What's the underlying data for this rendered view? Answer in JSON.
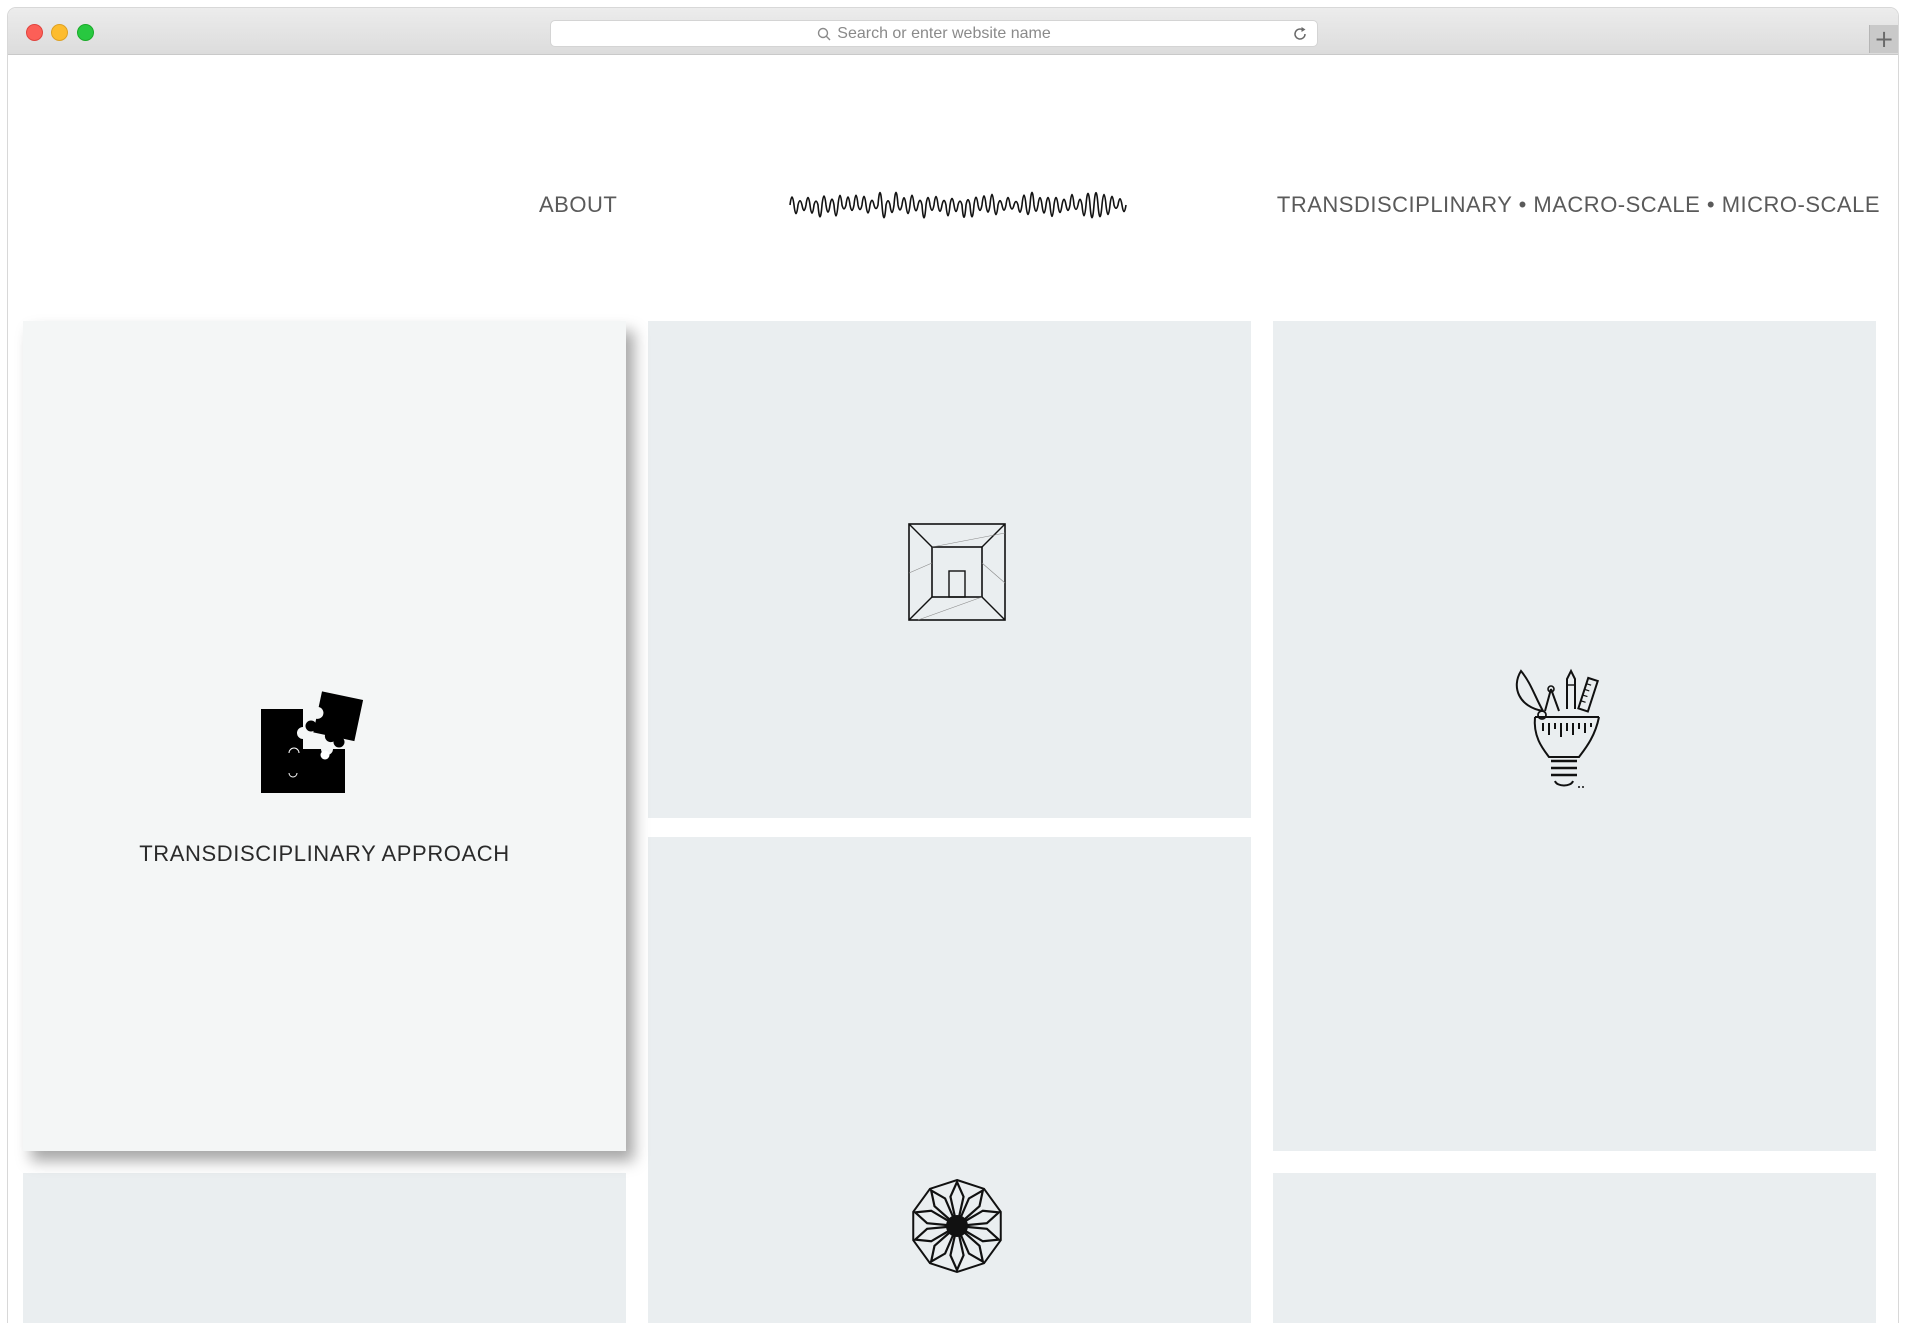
{
  "browser": {
    "address_placeholder": "Search or enter website name",
    "new_tab_label": "+",
    "traffic_lights": [
      "close",
      "minimize",
      "zoom"
    ]
  },
  "nav": {
    "about_label": "ABOUT",
    "logo_icon": "waveform-logo-icon",
    "right_label": "TRANSDISCIPLINARY • MACRO-SCALE • MICRO-SCALE"
  },
  "tiles": [
    {
      "icon": "puzzle-icon",
      "label": "TRANSDISCIPLINARY APPROACH",
      "featured": true
    },
    {
      "icon": "room-perspective-icon",
      "label": ""
    },
    {
      "icon": "lightbulb-tools-icon",
      "label": ""
    },
    {
      "icon": "geometric-flower-icon",
      "label": ""
    }
  ],
  "colors": {
    "tile_bg": "#eaeef0",
    "featured_bg": "#f4f6f6",
    "nav_text": "#5a5a5a"
  }
}
